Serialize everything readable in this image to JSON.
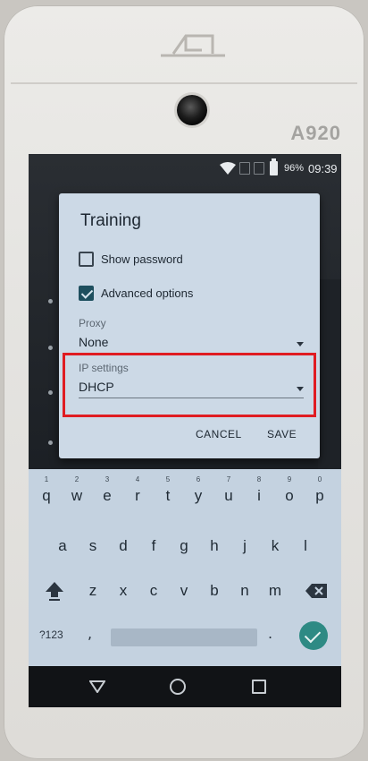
{
  "device": {
    "model": "A920"
  },
  "status_bar": {
    "battery_percent": "96%",
    "time": "09:39"
  },
  "dialog": {
    "title": "Training",
    "show_password_label": "Show password",
    "show_password_checked": false,
    "advanced_options_label": "Advanced options",
    "advanced_options_checked": true,
    "proxy": {
      "caption": "Proxy",
      "value": "None"
    },
    "ip_settings": {
      "caption": "IP settings",
      "value": "DHCP"
    },
    "cancel_label": "CANCEL",
    "save_label": "SAVE"
  },
  "keyboard": {
    "row1": [
      {
        "key": "q",
        "hint": "1"
      },
      {
        "key": "w",
        "hint": "2"
      },
      {
        "key": "e",
        "hint": "3"
      },
      {
        "key": "r",
        "hint": "4"
      },
      {
        "key": "t",
        "hint": "5"
      },
      {
        "key": "y",
        "hint": "6"
      },
      {
        "key": "u",
        "hint": "7"
      },
      {
        "key": "i",
        "hint": "8"
      },
      {
        "key": "o",
        "hint": "9"
      },
      {
        "key": "p",
        "hint": "0"
      }
    ],
    "row2": [
      "a",
      "s",
      "d",
      "f",
      "g",
      "h",
      "j",
      "k",
      "l"
    ],
    "row3": [
      "z",
      "x",
      "c",
      "v",
      "b",
      "n",
      "m"
    ],
    "symbols_label": "?123",
    "comma_label": ",",
    "period_label": "."
  },
  "colors": {
    "highlight": "#e01c22",
    "accent": "#2e8a84",
    "dialog_bg": "#ccd9e6"
  }
}
